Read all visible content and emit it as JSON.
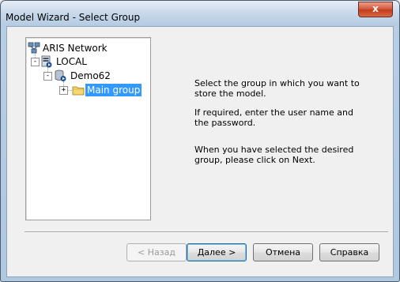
{
  "window": {
    "title": "Model Wizard - Select Group",
    "close_glyph": "x"
  },
  "tree": {
    "root": {
      "label": "ARIS Network",
      "icon": "network-icon"
    },
    "server": {
      "label": "LOCAL",
      "icon": "server-icon",
      "expander": "-"
    },
    "database": {
      "label": "Demo62",
      "icon": "database-icon",
      "expander": "-"
    },
    "group": {
      "label": "Main group",
      "icon": "folder-icon",
      "expander": "+",
      "selected": true
    }
  },
  "info": {
    "line1": "Select the group in which you want to store the model.",
    "line2": "If required, enter the user name and the password.",
    "line3": "When you have selected the desired group, please click on Next."
  },
  "buttons": {
    "back": "< Назад",
    "next": "Далее >",
    "cancel": "Отмена",
    "help": "Справка"
  },
  "colors": {
    "selection": "#3399ff",
    "close_button": "#c33a1c"
  }
}
